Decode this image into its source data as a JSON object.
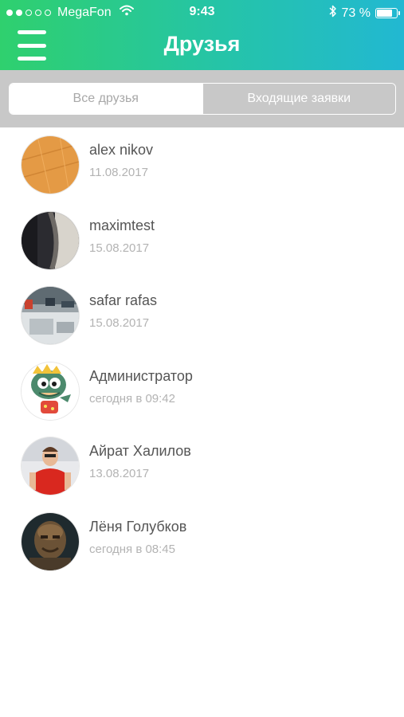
{
  "status_bar": {
    "carrier": "MegaFon",
    "time": "9:43",
    "battery_text": "73 %",
    "battery_level": 0.73,
    "signal_bars": 2,
    "signal_total": 5
  },
  "header": {
    "title": "Друзья",
    "menu_icon": "hamburger-menu-icon"
  },
  "tabs": [
    {
      "label": "Все друзья",
      "active": true
    },
    {
      "label": "Входящие заявки",
      "active": false
    }
  ],
  "friends": [
    {
      "name": "alex nikov",
      "date": "11.08.2017",
      "avatar": "orange-pattern"
    },
    {
      "name": "maximtest",
      "date": "15.08.2017",
      "avatar": "dark-photo"
    },
    {
      "name": "safar rafas",
      "date": "15.08.2017",
      "avatar": "street-photo"
    },
    {
      "name": "Администратор",
      "date": "сегодня в 09:42",
      "avatar": "dino-mascot"
    },
    {
      "name": "Айрат Халилов",
      "date": "13.08.2017",
      "avatar": "person-red-shirt"
    },
    {
      "name": "Лёня Голубков",
      "date": "сегодня в 08:45",
      "avatar": "brown-portrait"
    }
  ],
  "colors": {
    "header_gradient_start": "#2fd06e",
    "header_gradient_end": "#22b8d2",
    "segment_bar": "#c8c8c8",
    "name_text": "#555555",
    "date_text": "#b3b3b3"
  }
}
